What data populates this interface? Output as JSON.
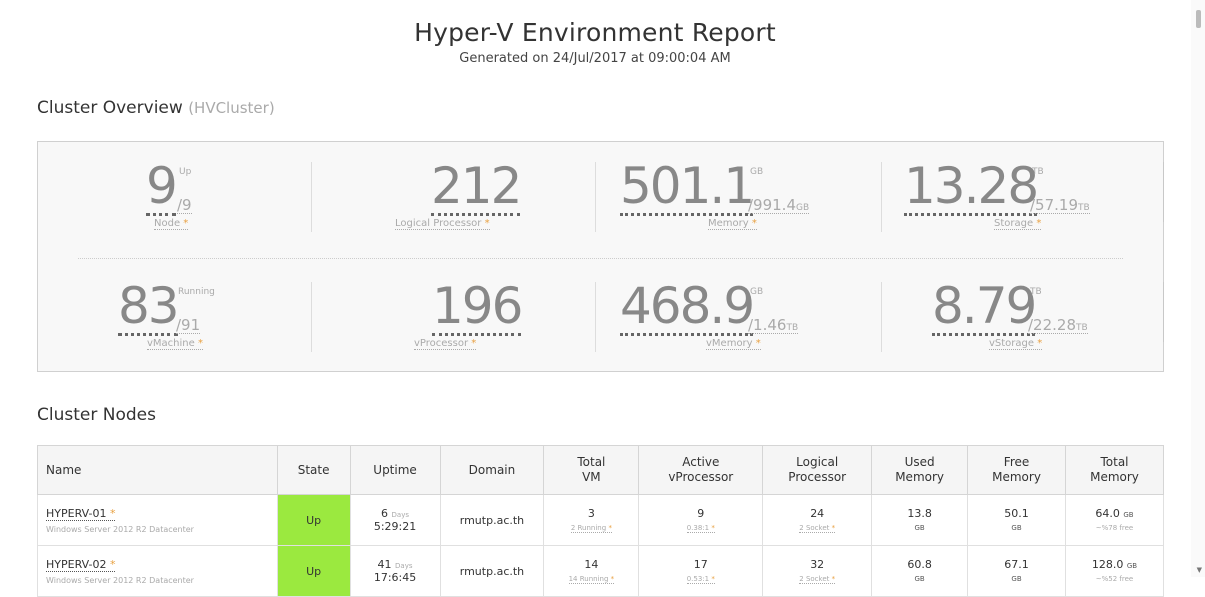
{
  "header": {
    "title": "Hyper-V Environment Report",
    "subtitle": "Generated on 24/Jul/2017 at 09:00:04 AM"
  },
  "overview": {
    "title": "Cluster Overview",
    "cluster_name": "(HVCluster)",
    "node": {
      "value": "9",
      "sup": "Up",
      "total": "/9",
      "label": "Node"
    },
    "lp": {
      "value": "212",
      "label": "Logical Processor"
    },
    "memory": {
      "value": "501.1",
      "sup": "GB",
      "total": "/991.4",
      "unit": "GB",
      "label": "Memory"
    },
    "storage": {
      "value": "13.28",
      "sup": "TB",
      "total": "/57.19",
      "unit": "TB",
      "label": "Storage"
    },
    "vm": {
      "value": "83",
      "sup": "Running",
      "total": "/91",
      "label": "vMachine"
    },
    "vp": {
      "value": "196",
      "label": "vProcessor"
    },
    "vmem": {
      "value": "468.9",
      "sup": "GB",
      "total": "/1.46",
      "unit": "TB",
      "label": "vMemory"
    },
    "vstorage": {
      "value": "8.79",
      "sup": "TB",
      "total": "/22.28",
      "unit": "TB",
      "label": "vStorage"
    },
    "star": "*"
  },
  "nodes": {
    "title": "Cluster Nodes",
    "headers": {
      "name": "Name",
      "state": "State",
      "uptime": "Uptime",
      "domain": "Domain",
      "total_vm_1": "Total",
      "total_vm_2": "VM",
      "vproc_1": "Active",
      "vproc_2": "vProcessor",
      "lproc_1": "Logical",
      "lproc_2": "Processor",
      "used_1": "Used",
      "used_2": "Memory",
      "free_1": "Free",
      "free_2": "Memory",
      "total_1": "Total",
      "total_2": "Memory"
    },
    "rows": [
      {
        "name": "HYPERV-01",
        "os": "Windows Server 2012 R2 Datacenter",
        "state": "Up",
        "uptime_days": "6",
        "days_label": "Days",
        "uptime_time": "5:29:21",
        "domain": "rmutp.ac.th",
        "total_vm": "3",
        "running": "2 Running",
        "vproc": "9",
        "ratio": "0.38:1",
        "lproc": "24",
        "socket": "2 Socket",
        "used": "13.8",
        "used_unit": "GB",
        "free": "50.1",
        "free_unit": "GB",
        "total": "64.0",
        "total_unit": "GB",
        "free_pct": "~%78 free"
      },
      {
        "name": "HYPERV-02",
        "os": "Windows Server 2012 R2 Datacenter",
        "state": "Up",
        "uptime_days": "41",
        "days_label": "Days",
        "uptime_time": "17:6:45",
        "domain": "rmutp.ac.th",
        "total_vm": "14",
        "running": "14 Running",
        "vproc": "17",
        "ratio": "0.53:1",
        "lproc": "32",
        "socket": "2 Socket",
        "used": "60.8",
        "used_unit": "GB",
        "free": "67.1",
        "free_unit": "GB",
        "total": "128.0",
        "total_unit": "GB",
        "free_pct": "~%52 free"
      }
    ]
  }
}
